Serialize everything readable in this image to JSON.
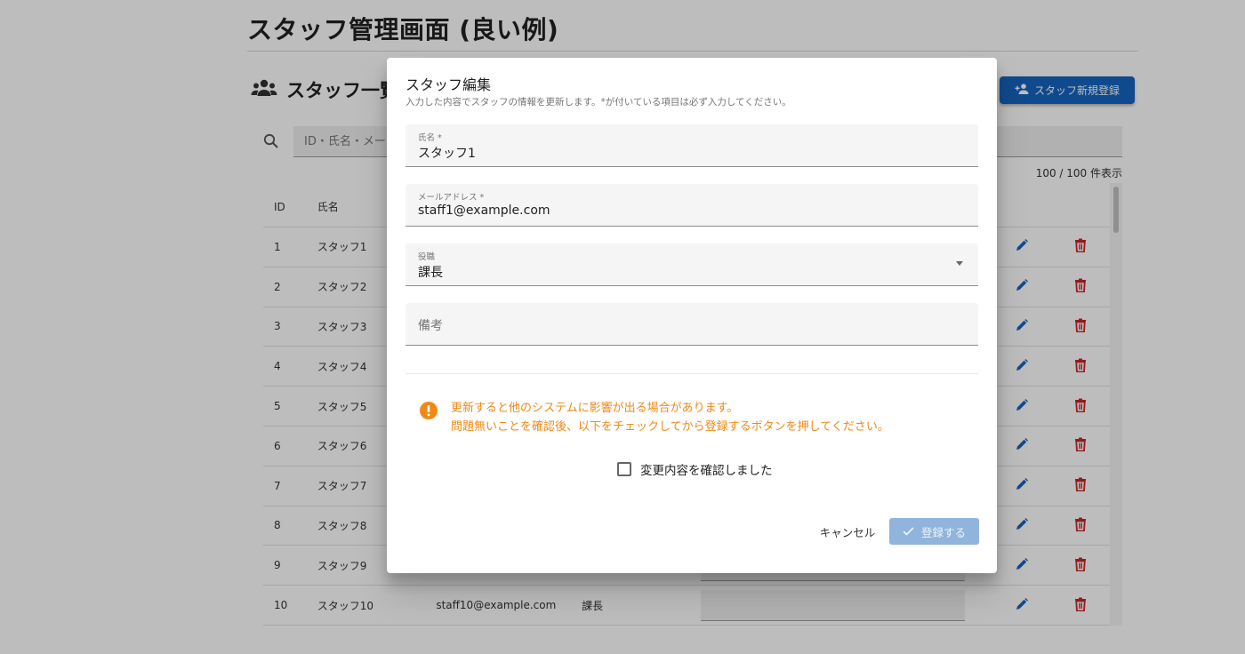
{
  "page": {
    "title": "スタッフ管理画面 (良い例)",
    "section_title": "スタッフ一覧",
    "new_button_label": "スタッフ新規登録",
    "search_placeholder": "ID・氏名・メー",
    "count_text": "100 / 100 件表示"
  },
  "table": {
    "headers": {
      "id": "ID",
      "name": "氏名"
    },
    "rows": [
      {
        "id": "1",
        "name": "スタッフ1"
      },
      {
        "id": "2",
        "name": "スタッフ2"
      },
      {
        "id": "3",
        "name": "スタッフ3"
      },
      {
        "id": "4",
        "name": "スタッフ4"
      },
      {
        "id": "5",
        "name": "スタッフ5"
      },
      {
        "id": "6",
        "name": "スタッフ6"
      },
      {
        "id": "7",
        "name": "スタッフ7"
      },
      {
        "id": "8",
        "name": "スタッフ8"
      },
      {
        "id": "9",
        "name": "スタッフ9"
      },
      {
        "id": "10",
        "name": "スタッフ10",
        "email": "staff10@example.com",
        "role": "課長"
      }
    ]
  },
  "dialog": {
    "title": "スタッフ編集",
    "subtitle": "入力した内容でスタッフの情報を更新します。*が付いている項目は必ず入力してください。",
    "fields": {
      "name": {
        "label": "氏名 *",
        "value": "スタッフ1"
      },
      "email": {
        "label": "メールアドレス *",
        "value": "staff1@example.com"
      },
      "role": {
        "label": "役職",
        "value": "課長"
      },
      "note": {
        "placeholder": "備考"
      }
    },
    "warning": {
      "line1": "更新すると他のシステムに影響が出る場合があります。",
      "line2": "問題無いことを確認後、以下をチェックしてから登録するボタンを押してください。"
    },
    "confirm_checkbox_label": "変更内容を確認しました",
    "cancel_label": "キャンセル",
    "submit_label": "登録する"
  },
  "colors": {
    "primary": "#1565c0",
    "danger": "#c62828",
    "warning": "#ef8a17",
    "submit_disabled": "#90b4dc"
  },
  "icons": {
    "section": "group-icon",
    "new_button": "person-add-icon",
    "search": "search-icon",
    "edit": "pencil-icon",
    "delete": "trash-icon",
    "warning": "exclamation-circle-icon",
    "submit": "check-icon"
  }
}
